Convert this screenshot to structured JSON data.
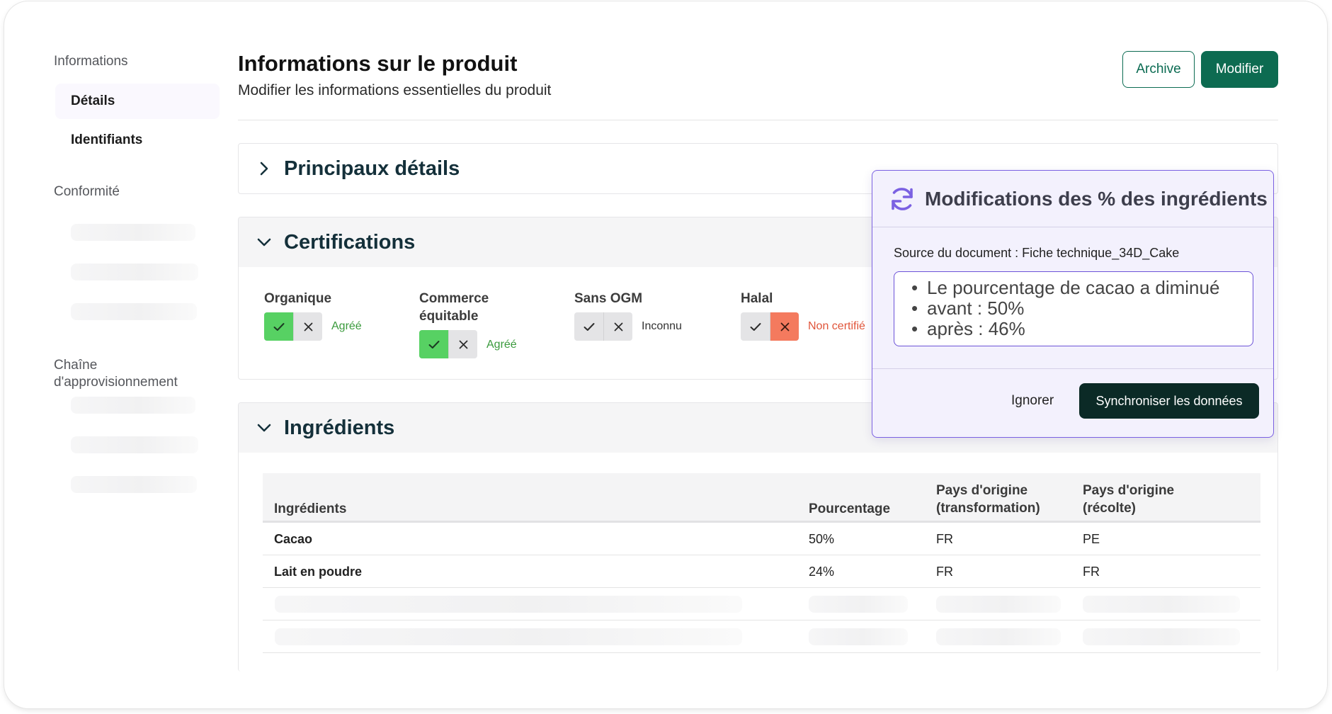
{
  "sidebar": {
    "section_informations": "Informations",
    "items_informations": [
      {
        "label": "Détails"
      },
      {
        "label": "Identifiants"
      }
    ],
    "section_conformite": "Conformité",
    "section_chaine": "Chaîne d'approvisionnement"
  },
  "header": {
    "title": "Informations sur le produit",
    "subtitle": "Modifier les informations essentielles du produit",
    "archive_label": "Archive",
    "modifier_label": "Modifier"
  },
  "sections": {
    "principaux": {
      "title": "Principaux détails",
      "expanded": false
    },
    "certifications": {
      "title": "Certifications",
      "expanded": true
    },
    "ingredients": {
      "title": "Ingrédients",
      "expanded": true
    }
  },
  "certifications": [
    {
      "label": "Organique",
      "state": "yes",
      "status": "Agréé"
    },
    {
      "label": "Commerce équitable",
      "state": "yes",
      "status": "Agréé"
    },
    {
      "label": "Sans OGM",
      "state": "unknown",
      "status": "Inconnu"
    },
    {
      "label": "Halal",
      "state": "no",
      "status": "Non certifié"
    }
  ],
  "ingredients_table": {
    "headers": [
      "Ingrédients",
      "Pourcentage",
      "Pays d'origine (transformation)",
      "Pays d'origine (récolte)"
    ],
    "rows": [
      [
        "Cacao",
        "50%",
        "FR",
        "PE"
      ],
      [
        "Lait en poudre",
        "24%",
        "FR",
        "FR"
      ]
    ]
  },
  "popover": {
    "title": "Modifications des % des ingrédients",
    "source": "Source du document : Fiche technique_34D_Cake",
    "changes": [
      "Le pourcentage de cacao a diminué",
      "avant : 50%",
      "après : 46%"
    ],
    "ignore_label": "Ignorer",
    "sync_label": "Synchroniser les données"
  },
  "colors": {
    "brand": "#0d6b51",
    "approved": "#3a9a3c",
    "approved_toggle": "#57d163",
    "rejected": "#e0553a",
    "rejected_toggle": "#f47a5e",
    "popover_accent": "#7b61e2",
    "sync_button": "#0b2a26"
  },
  "icons": {
    "section_collapsed": "chevron-right-icon",
    "section_expanded": "chevron-down-icon",
    "toggle_yes": "check-icon",
    "toggle_no": "close-icon",
    "popover": "refresh-icon"
  }
}
